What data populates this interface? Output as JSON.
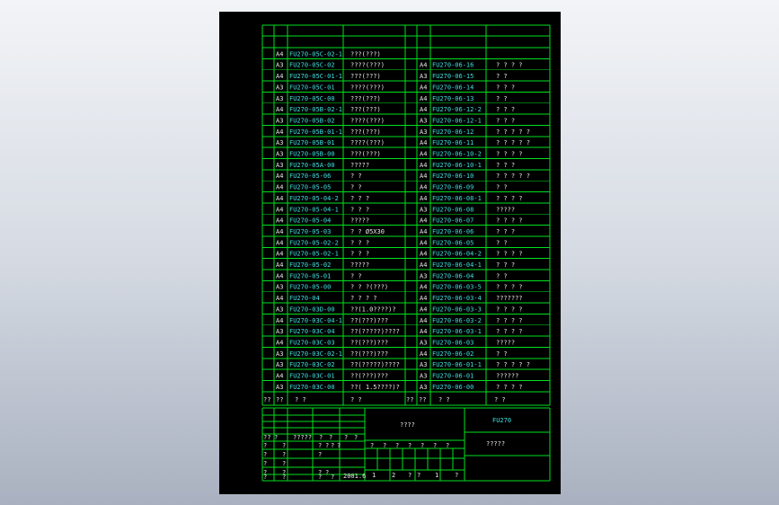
{
  "left_rows": [
    {
      "fmt": "A4",
      "code": "FU270-05C-02-1",
      "name": "???(???)"
    },
    {
      "fmt": "A3",
      "code": "FU270-05C-02",
      "name": "????(???)"
    },
    {
      "fmt": "A4",
      "code": "FU270-05C-01-1",
      "name": "???(???)"
    },
    {
      "fmt": "A3",
      "code": "FU270-05C-01",
      "name": "????(???)"
    },
    {
      "fmt": "A3",
      "code": "FU270-05C-00",
      "name": "???(???)"
    },
    {
      "fmt": "A4",
      "code": "FU270-05B-02-1",
      "name": "???(???)"
    },
    {
      "fmt": "A3",
      "code": "FU270-05B-02",
      "name": "????(???)"
    },
    {
      "fmt": "A4",
      "code": "FU270-05B-01-1",
      "name": "???(???)"
    },
    {
      "fmt": "A3",
      "code": "FU270-05B-01",
      "name": "????(???)"
    },
    {
      "fmt": "A3",
      "code": "FU270-05B-00",
      "name": "???(???)"
    },
    {
      "fmt": "A3",
      "code": "FU270-05A-00",
      "name": "?????"
    },
    {
      "fmt": "A4",
      "code": "FU270-05-06",
      "name": "?   ?"
    },
    {
      "fmt": "A4",
      "code": "FU270-05-05",
      "name": "?   ?"
    },
    {
      "fmt": "A4",
      "code": "FU270-05-04-2",
      "name": "?  ?  ?"
    },
    {
      "fmt": "A4",
      "code": "FU270-05-04-1",
      "name": "?  ?  ?"
    },
    {
      "fmt": "A4",
      "code": "FU270-05-04",
      "name": "?????"
    },
    {
      "fmt": "A4",
      "code": "FU270-05-03",
      "name": "?  ?  Ø5X30"
    },
    {
      "fmt": "A4",
      "code": "FU270-05-02-2",
      "name": "?  ?  ?"
    },
    {
      "fmt": "A4",
      "code": "FU270-05-02-1",
      "name": "?  ?  ?"
    },
    {
      "fmt": "A4",
      "code": "FU270-05-02",
      "name": "?????"
    },
    {
      "fmt": "A4",
      "code": "FU270-05-01",
      "name": "?   ?"
    },
    {
      "fmt": "A3",
      "code": "FU270-05-00",
      "name": "?  ?  ?(???)"
    },
    {
      "fmt": "A4",
      "code": "FU270-04",
      "name": "?  ?  ?  ?"
    },
    {
      "fmt": "A3",
      "code": "FU270-03D-00",
      "name": "??(1.0????)?"
    },
    {
      "fmt": "A4",
      "code": "FU270-03C-04-1",
      "name": "??(???)???"
    },
    {
      "fmt": "A3",
      "code": "FU270-03C-04",
      "name": "??(?????)????"
    },
    {
      "fmt": "A4",
      "code": "FU270-03C-03",
      "name": "??(???)???"
    },
    {
      "fmt": "A3",
      "code": "FU270-03C-02-1",
      "name": "??(???)???"
    },
    {
      "fmt": "A3",
      "code": "FU270-03C-02",
      "name": "??(?????)????"
    },
    {
      "fmt": "A4",
      "code": "FU270-03C-01",
      "name": "??(???)???"
    },
    {
      "fmt": "A3",
      "code": "FU270-03C-00",
      "name": "??( 1.5????)?"
    }
  ],
  "right_rows": [
    {
      "fmt": "A4",
      "code": "FU270-06-16",
      "name": "?  ?  ?  ?"
    },
    {
      "fmt": "A3",
      "code": "FU270-06-15",
      "name": "?     ?"
    },
    {
      "fmt": "A4",
      "code": "FU270-06-14",
      "name": "?  ?  ?"
    },
    {
      "fmt": "A4",
      "code": "FU270-06-13",
      "name": "?     ?"
    },
    {
      "fmt": "A4",
      "code": "FU270-06-12-2",
      "name": "?   ?   ?"
    },
    {
      "fmt": "A3",
      "code": "FU270-06-12-1",
      "name": "?   ?   ?"
    },
    {
      "fmt": "A3",
      "code": "FU270-06-12",
      "name": "?  ?  ?  ?  ?"
    },
    {
      "fmt": "A4",
      "code": "FU270-06-11",
      "name": "?  ?  ?  ?  ?"
    },
    {
      "fmt": "A4",
      "code": "FU270-06-10-2",
      "name": "?  ?  ?  ?"
    },
    {
      "fmt": "A4",
      "code": "FU270-06-10-1",
      "name": "?   ?   ?"
    },
    {
      "fmt": "A4",
      "code": "FU270-06-10",
      "name": "?  ?  ?  ?  ?"
    },
    {
      "fmt": "A4",
      "code": "FU270-06-09",
      "name": "?     ?"
    },
    {
      "fmt": "A4",
      "code": "FU270-06-08-1",
      "name": "?  ?  ?  ?"
    },
    {
      "fmt": "A3",
      "code": "FU270-06-08",
      "name": "?????"
    },
    {
      "fmt": "A4",
      "code": "FU270-06-07",
      "name": "?  ?  ?  ?"
    },
    {
      "fmt": "A4",
      "code": "FU270-06-06",
      "name": "?   ?   ?"
    },
    {
      "fmt": "A4",
      "code": "FU270-06-05",
      "name": "?     ?"
    },
    {
      "fmt": "A4",
      "code": "FU270-06-04-2",
      "name": "?  ?  ?  ?"
    },
    {
      "fmt": "A4",
      "code": "FU270-06-04-1",
      "name": "?   ?   ?"
    },
    {
      "fmt": "A3",
      "code": "FU270-06-04",
      "name": "?     ?"
    },
    {
      "fmt": "A4",
      "code": "FU270-06-03-5",
      "name": "?  ?  ?  ?"
    },
    {
      "fmt": "A4",
      "code": "FU270-06-03-4",
      "name": "???????"
    },
    {
      "fmt": "A4",
      "code": "FU270-06-03-3",
      "name": "?  ?  ?  ?"
    },
    {
      "fmt": "A4",
      "code": "FU270-06-03-2",
      "name": "?  ?  ?  ?"
    },
    {
      "fmt": "A4",
      "code": "FU270-06-03-1",
      "name": "?  ?  ?  ?"
    },
    {
      "fmt": "A3",
      "code": "FU270-06-03",
      "name": "?????"
    },
    {
      "fmt": "A4",
      "code": "FU270-06-02",
      "name": "?     ?"
    },
    {
      "fmt": "A3",
      "code": "FU270-06-01-1",
      "name": "?  ?  ?  ?  ?"
    },
    {
      "fmt": "A3",
      "code": "FU270-06-01",
      "name": "??????"
    },
    {
      "fmt": "A3",
      "code": "FU270-06-00",
      "name": "?  ?  ?  ?"
    }
  ],
  "footer_row": [
    "??",
    "??",
    "?    ?",
    "?      ?",
    "??",
    "??",
    "?    ?",
    "?      ?"
  ],
  "title_block": {
    "drawing_name": "????",
    "project_code": "FU270",
    "subtitle": "?????",
    "date": "2001.6",
    "r1": [
      "??",
      "?",
      "?????",
      "?",
      "?",
      "?",
      "?"
    ],
    "r2": [
      "?",
      "?",
      "?",
      "?",
      "?",
      "?",
      "?",
      "?",
      "?",
      "?",
      "?",
      "?",
      "?"
    ],
    "r3": [
      "?",
      "?",
      "?"
    ],
    "r4": [
      "?",
      "?",
      "?",
      "?",
      "?",
      "?"
    ],
    "r5": [
      "?",
      "?",
      "?",
      "?",
      "1",
      "2",
      "?",
      "?",
      "1",
      "?"
    ]
  }
}
